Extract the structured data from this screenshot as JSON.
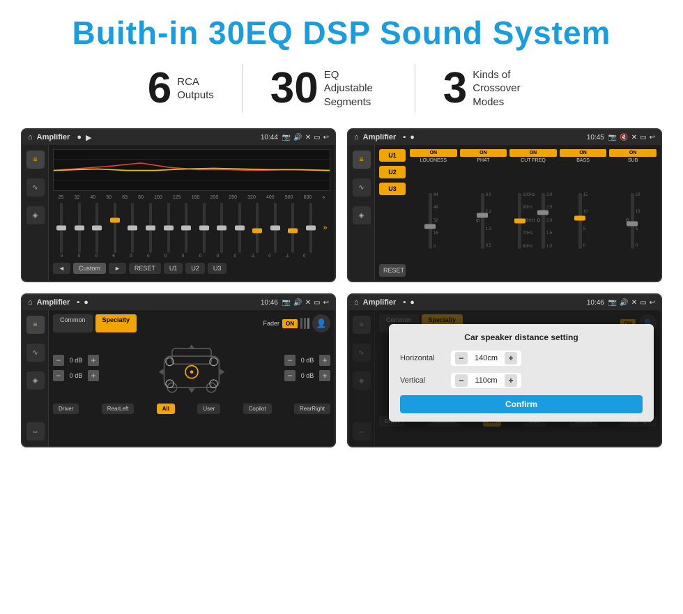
{
  "header": {
    "title": "Buith-in 30EQ DSP Sound System"
  },
  "stats": [
    {
      "number": "6",
      "label": "RCA\nOutputs"
    },
    {
      "number": "30",
      "label": "EQ Adjustable\nSegments"
    },
    {
      "number": "3",
      "label": "Kinds of\nCrossover Modes"
    }
  ],
  "screen1": {
    "app": "Amplifier",
    "time": "10:44",
    "eq_freqs": [
      "25",
      "32",
      "40",
      "50",
      "63",
      "80",
      "100",
      "125",
      "160",
      "200",
      "250",
      "320",
      "400",
      "500",
      "630"
    ],
    "eq_vals": [
      "0",
      "0",
      "0",
      "5",
      "0",
      "0",
      "0",
      "0",
      "0",
      "0",
      "0",
      "-1",
      "0",
      "-1",
      "0"
    ],
    "bottom_btns": [
      "◄",
      "Custom",
      "►",
      "RESET",
      "U1",
      "U2",
      "U3"
    ]
  },
  "screen2": {
    "app": "Amplifier",
    "time": "10:45",
    "presets": [
      "U1",
      "U2",
      "U3"
    ],
    "channels": [
      {
        "toggle": "ON",
        "label": "LOUDNESS"
      },
      {
        "toggle": "ON",
        "label": "PHAT"
      },
      {
        "toggle": "ON",
        "label": "CUT FREQ"
      },
      {
        "toggle": "ON",
        "label": "BASS"
      },
      {
        "toggle": "ON",
        "label": "SUB"
      }
    ],
    "reset_btn": "RESET"
  },
  "screen3": {
    "app": "Amplifier",
    "time": "10:46",
    "tabs": [
      "Common",
      "Specialty"
    ],
    "fader_label": "Fader",
    "fader_toggle": "ON",
    "db_values": [
      "0 dB",
      "0 dB",
      "0 dB",
      "0 dB"
    ],
    "buttons": [
      "Driver",
      "RearLeft",
      "All",
      "User",
      "Copilot",
      "RearRight"
    ]
  },
  "screen4": {
    "app": "Amplifier",
    "time": "10:46",
    "tabs": [
      "Common",
      "Specialty"
    ],
    "dialog": {
      "title": "Car speaker distance setting",
      "horizontal_label": "Horizontal",
      "horizontal_value": "140cm",
      "vertical_label": "Vertical",
      "vertical_value": "110cm",
      "confirm_btn": "Confirm"
    },
    "buttons": [
      "Driver",
      "RearLeft",
      "All",
      "User",
      "Copilot",
      "RearRight"
    ]
  },
  "colors": {
    "accent": "#1a9de0",
    "title_blue": "#1a9de0",
    "orange": "#f0a500",
    "bg_dark": "#1c1c1c",
    "text_white": "#ffffff"
  }
}
